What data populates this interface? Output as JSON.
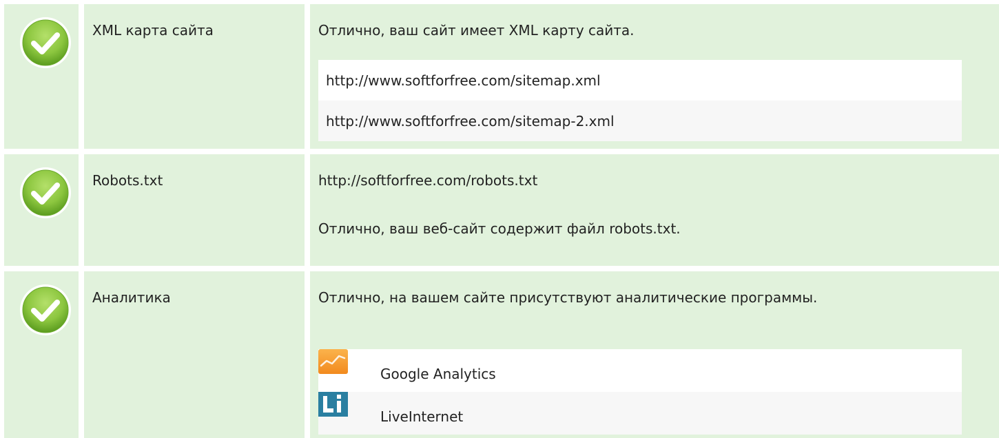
{
  "checks": [
    {
      "label": "XML карта сайта",
      "status": "pass",
      "message": "Отлично, ваш сайт имеет XML карту сайта.",
      "items": [
        "http://www.softforfree.com/sitemap.xml",
        "http://www.softforfree.com/sitemap-2.xml"
      ]
    },
    {
      "label": "Robots.txt",
      "status": "pass",
      "url": "http://softforfree.com/robots.txt",
      "message": "Отлично, ваш веб-сайт содержит файл robots.txt."
    },
    {
      "label": "Аналитика",
      "status": "pass",
      "message": "Отлично, на вашем сайте присутствуют аналитические программы.",
      "tools": [
        {
          "name": "Google Analytics",
          "icon": "google-analytics-icon"
        },
        {
          "name": "LiveInternet",
          "icon": "liveinternet-icon"
        }
      ]
    }
  ],
  "colors": {
    "cell_bg": "#e1f2dc",
    "check_green": "#8cc63f",
    "check_dark": "#5a9b1e",
    "ga_orange": "#f7a136",
    "li_blue": "#2a7fa1"
  }
}
